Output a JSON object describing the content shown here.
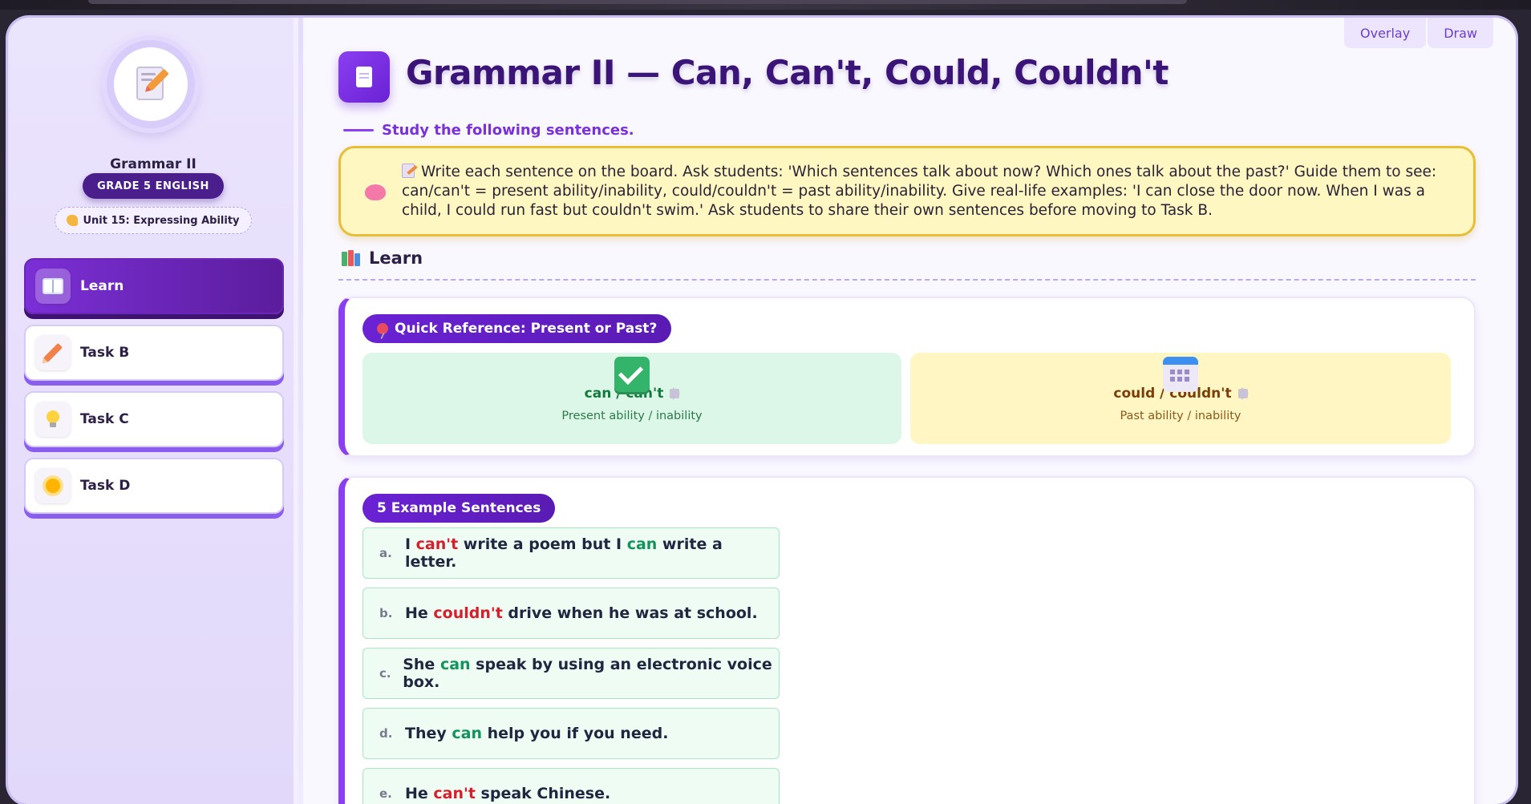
{
  "sidebar": {
    "title": "Grammar II",
    "grade": "GRADE 5 ENGLISH",
    "unit": "Unit 15: Expressing Ability",
    "unit_icon": "flexed-biceps-icon",
    "nav": [
      {
        "label": "Learn",
        "icon": "open-book-icon",
        "active": true
      },
      {
        "label": "Task B",
        "icon": "pencil-icon",
        "active": false
      },
      {
        "label": "Task C",
        "icon": "lightbulb-icon",
        "active": false
      },
      {
        "label": "Task D",
        "icon": "sun-icon",
        "active": false
      }
    ]
  },
  "toolbar": {
    "overlay": "Overlay",
    "draw": "Draw"
  },
  "main": {
    "title": "Grammar II — Can, Can't, Could, Couldn't",
    "subtitle": "Study the following sentences.",
    "teacher_note": "Write each sentence on the board. Ask students: 'Which sentences talk about now? Which ones talk about the past?' Guide them to see: can/can't = present ability/inability, could/couldn't = past ability/inability. Give real-life examples: 'I can close the door now. When I was a child, I could run fast but couldn't swim.' Ask students to share their own sentences before moving to Task B.",
    "section_title": "Learn",
    "quick_ref": {
      "title": "Quick Reference: Present or Past?",
      "present": {
        "term": "can / can't",
        "desc": "Present ability / inability"
      },
      "past": {
        "term": "could / couldn't",
        "desc": "Past ability / inability"
      }
    },
    "examples": {
      "title": "5 Example Sentences",
      "items": [
        {
          "letter": "a.",
          "parts": [
            "I ",
            "can't",
            " write a poem but I ",
            "can",
            " write a letter."
          ]
        },
        {
          "letter": "b.",
          "parts": [
            "He ",
            "couldn't",
            " drive when he was at school."
          ]
        },
        {
          "letter": "c.",
          "parts": [
            "She ",
            "can",
            " speak by using an electronic voice box."
          ]
        },
        {
          "letter": "d.",
          "parts": [
            "They ",
            "can",
            " help you if you need."
          ]
        },
        {
          "letter": "e.",
          "parts": [
            "He ",
            "can't",
            " speak Chinese."
          ]
        }
      ]
    }
  },
  "colors": {
    "accent": "#6a22d4",
    "positive": "#11935a",
    "negative": "#d81e2c",
    "note_bg": "#fff7c2"
  }
}
